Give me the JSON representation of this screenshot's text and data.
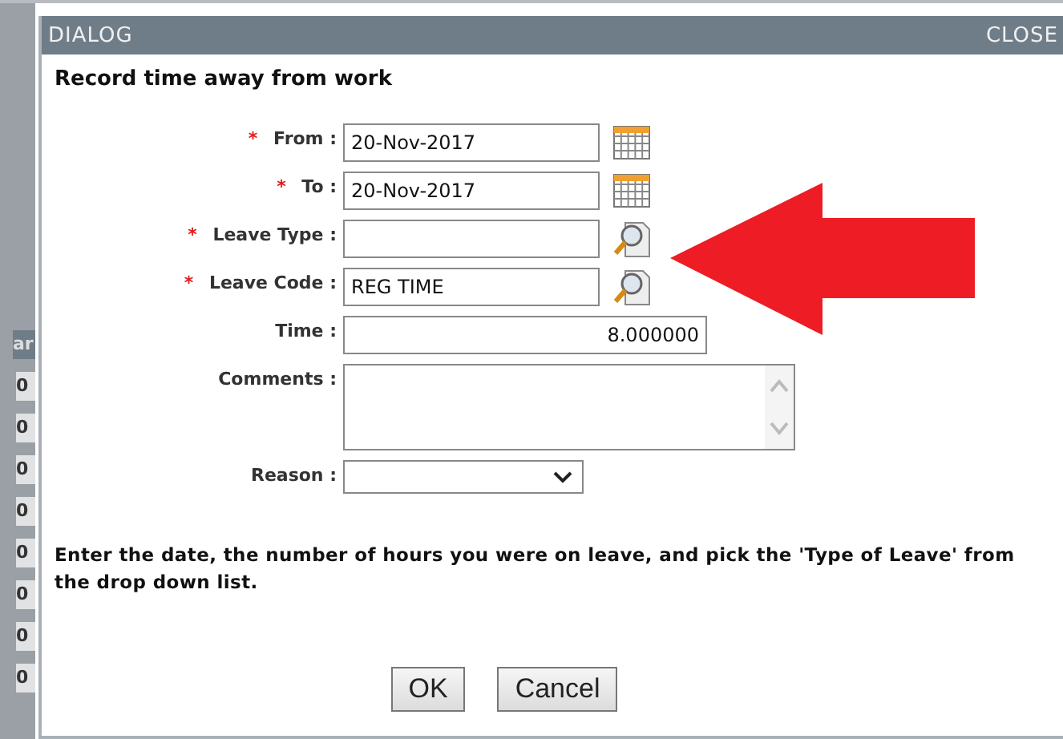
{
  "background_page": {
    "header_fragment": "ar",
    "cells": [
      "0",
      "0",
      "0",
      "0",
      "0",
      "0",
      "0",
      "0"
    ]
  },
  "dialog": {
    "title": "DIALOG",
    "close": "CLOSE",
    "heading": "Record time away from work",
    "fields": [
      {
        "label": "From :",
        "required": true,
        "kind": "date",
        "value": "20-Nov-2017"
      },
      {
        "label": "To :",
        "required": true,
        "kind": "date",
        "value": "20-Nov-2017"
      },
      {
        "label": "Leave Type :",
        "required": true,
        "kind": "lookup"
      },
      {
        "label": "Leave Code :",
        "required": true,
        "kind": "lookup",
        "value": "REG TIME"
      },
      {
        "label": "Time :",
        "required": false,
        "kind": "number",
        "value": "8.000000"
      },
      {
        "label": "Comments :",
        "required": false,
        "kind": "textarea"
      },
      {
        "label": "Reason :",
        "required": false,
        "kind": "select"
      }
    ],
    "required_mark": "*",
    "instructions": "Enter the date, the number of hours you were on leave, and pick the 'Type of Leave' from the drop down list.",
    "buttons": [
      "OK",
      "Cancel"
    ]
  },
  "annotation": {
    "kind": "arrow",
    "color": "#ee1c24"
  }
}
